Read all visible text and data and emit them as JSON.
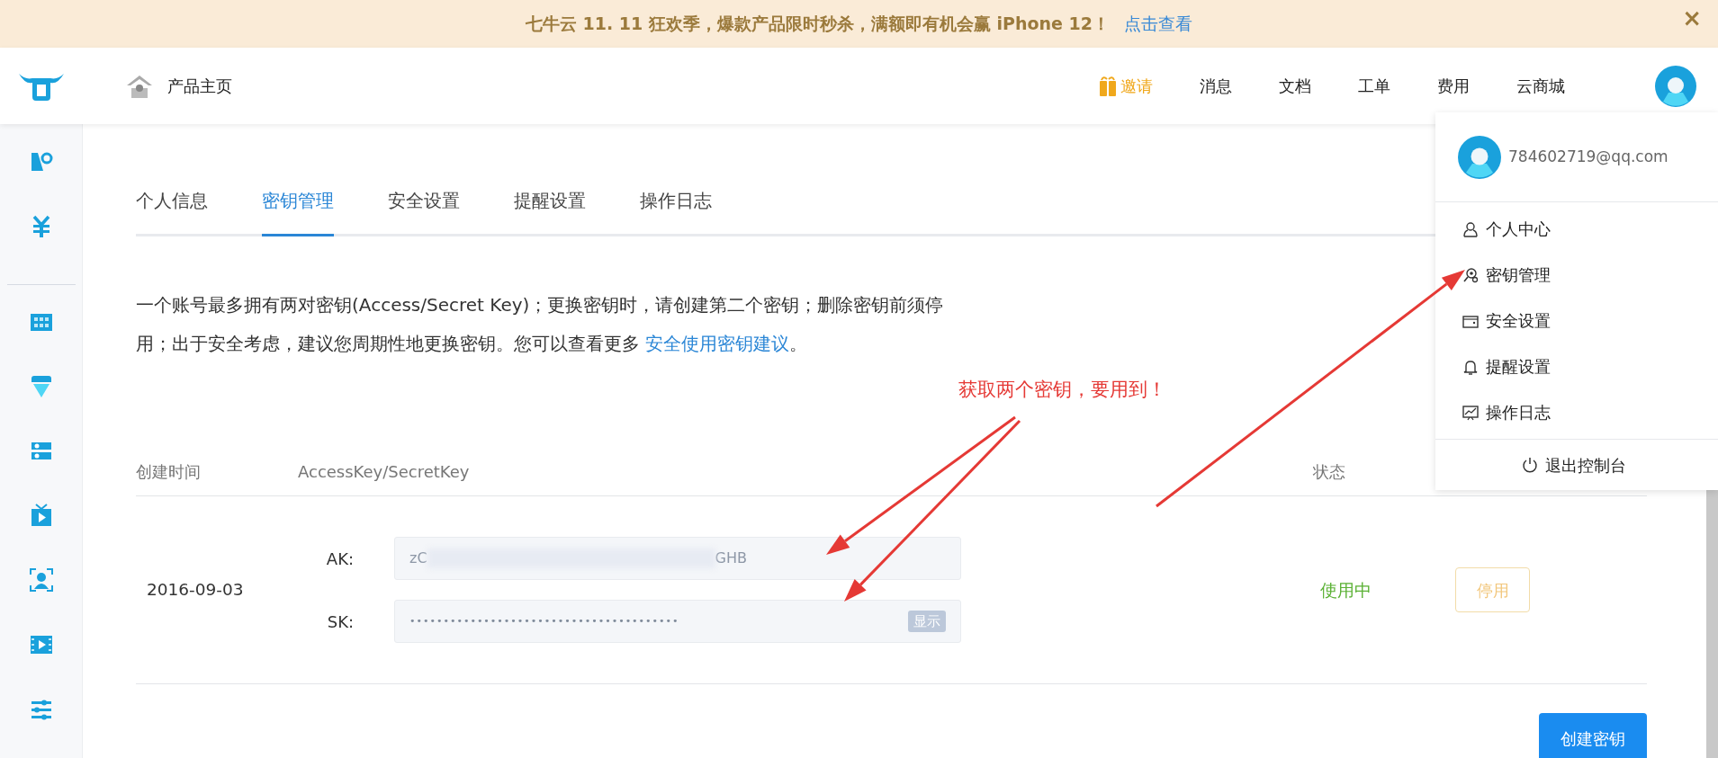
{
  "banner": {
    "text": "七牛云 11. 11 狂欢季，爆款产品限时秒杀，满额即有机会赢 iPhone 12！",
    "link": "点击查看",
    "close": "×"
  },
  "header": {
    "home": "产品主页",
    "nav": [
      {
        "label": "邀请",
        "kind": "invite"
      },
      {
        "label": "消息",
        "kind": "link"
      },
      {
        "label": "文档",
        "kind": "link"
      },
      {
        "label": "工单",
        "kind": "link"
      },
      {
        "label": "费用",
        "kind": "link"
      },
      {
        "label": "云商城",
        "kind": "link"
      }
    ]
  },
  "tabs": [
    {
      "label": "个人信息",
      "selected": false
    },
    {
      "label": "密钥管理",
      "selected": true
    },
    {
      "label": "安全设置",
      "selected": false
    },
    {
      "label": "提醒设置",
      "selected": false
    },
    {
      "label": "操作日志",
      "selected": false
    }
  ],
  "description": {
    "text": "一个账号最多拥有两对密钥(Access/Secret Key)；更换密钥时，请创建第二个密钥；删除密钥前须停用；出于安全考虑，建议您周期性地更换密钥。您可以查看更多 ",
    "link": "安全使用密钥建议",
    "end": "。"
  },
  "annotation": {
    "text": "获取两个密钥，要用到！"
  },
  "table": {
    "columns": [
      "创建时间",
      "AccessKey/SecretKey",
      "状态"
    ],
    "rows": [
      {
        "date": "2016-09-03",
        "ak_label": "AK:",
        "ak_start": "zC",
        "ak_end": "GHB",
        "sk_label": "SK:",
        "sk_value": "••••••••••••••••••••••••••••••••••••••••",
        "sk_show": "显示",
        "status": "使用中",
        "action": "停用"
      }
    ]
  },
  "create_button": "创建密钥",
  "user_menu": {
    "email": "784602719@qq.com",
    "items": [
      {
        "label": "个人中心",
        "kind": "user"
      },
      {
        "label": "密钥管理",
        "kind": "key"
      },
      {
        "label": "安全设置",
        "kind": "wallet"
      },
      {
        "label": "提醒设置",
        "kind": "bell"
      },
      {
        "label": "操作日志",
        "kind": "chart"
      }
    ],
    "logout": "退出控制台"
  }
}
